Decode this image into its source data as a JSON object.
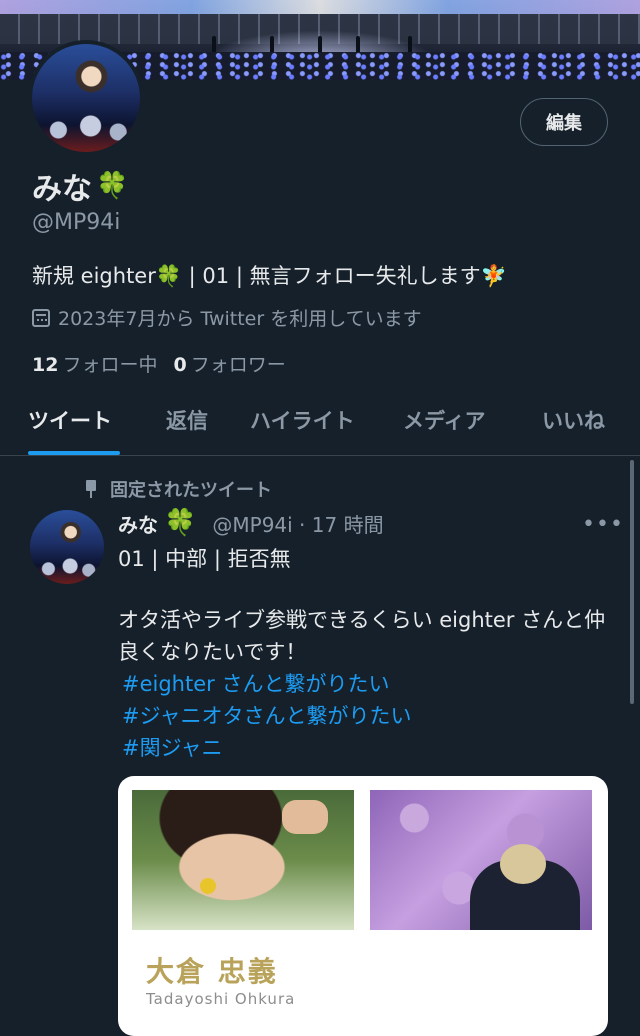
{
  "profile": {
    "edit_label": "編集",
    "name": "みな",
    "name_emoji": "🍀",
    "handle": "@MP94i",
    "bio": "新規 eighter🍀 | 01 | 無言フォロー失礼します🧚",
    "joined": "2023年7月から Twitter を利用しています",
    "following_count": "12",
    "following_label": "フォロー中",
    "followers_count": "0",
    "followers_label": "フォロワー"
  },
  "tabs": [
    "ツイート",
    "返信",
    "ハイライト",
    "メディア",
    "いいね"
  ],
  "tweet": {
    "pinned_label": "固定されたツイート",
    "name": "みな",
    "name_emoji": "🍀",
    "handle_time": "@MP94i · 17 時間",
    "line1": "01 | 中部 | 拒否無",
    "body": "オタ活やライブ参戦できるくらい eighter さんと仲良くなりたいです！",
    "hashtags": [
      "#eighter さんと繋がりたい",
      "#ジャニオタさんと繋がりたい",
      "#関ジャニ"
    ],
    "card_title": "大倉 忠義",
    "card_subtitle": "Tadayoshi Ohkura"
  },
  "colors": {
    "background": "#15202b",
    "accent": "#1d9bf0",
    "secondary_text": "#8b98a5",
    "clover": "#2fbf4a"
  },
  "icons": [
    "calendar-icon",
    "pin-icon",
    "more-icon",
    "clover-emoji"
  ]
}
